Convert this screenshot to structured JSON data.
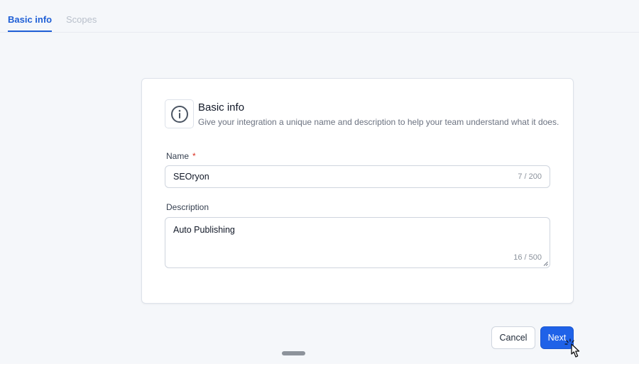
{
  "tabs": [
    {
      "label": "Basic info",
      "active": true
    },
    {
      "label": "Scopes",
      "active": false
    }
  ],
  "card": {
    "icon": "info-icon",
    "title": "Basic info",
    "subtitle": "Give your integration a unique name and description to help your team understand what it does."
  },
  "fields": {
    "name": {
      "label": "Name",
      "required_mark": "*",
      "value": "SEOryon",
      "counter": "7 / 200"
    },
    "description": {
      "label": "Description",
      "value": "Auto Publishing",
      "counter": "16 / 500"
    }
  },
  "actions": {
    "cancel_label": "Cancel",
    "next_label": "Next"
  },
  "colors": {
    "accent": "#1f62e8",
    "tab_active": "#1f5fd6",
    "required": "#d92d20"
  }
}
